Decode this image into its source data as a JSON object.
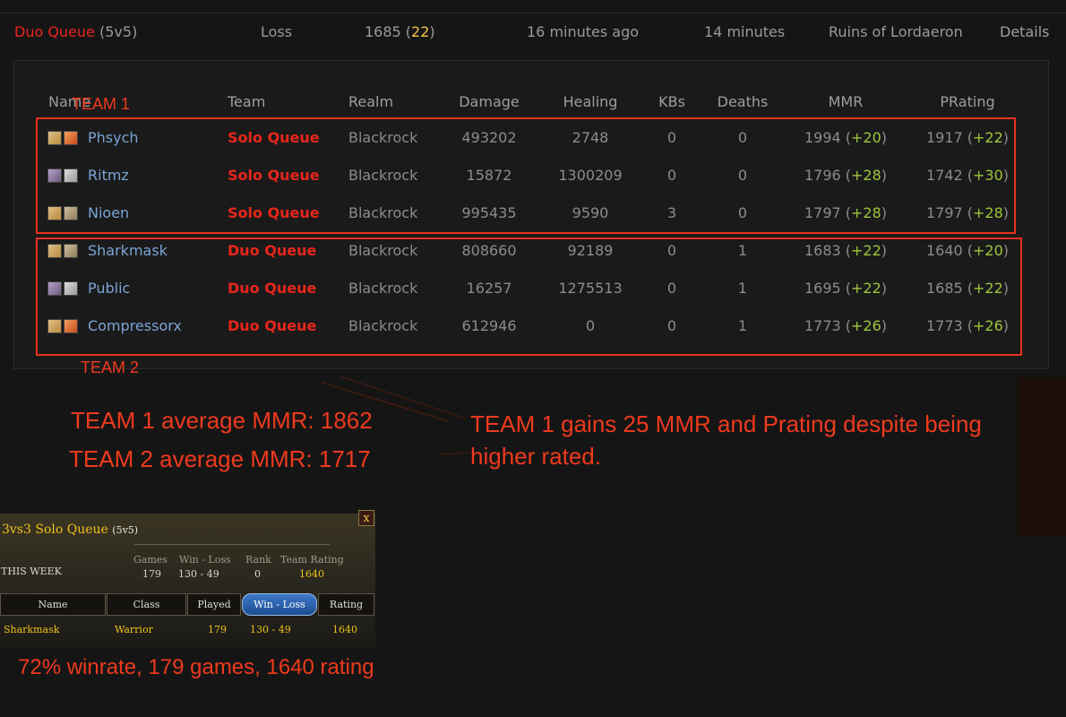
{
  "match": {
    "mode": "Duo Queue",
    "bracket": "(5v5)",
    "result": "Loss",
    "rating": "1685",
    "rating_change": "22",
    "time_ago": "16 minutes ago",
    "duration": "14 minutes",
    "map": "Ruins of Lordaeron",
    "details_label": "Details"
  },
  "table": {
    "headers": [
      "Name",
      "Team",
      "Realm",
      "Damage",
      "Healing",
      "KBs",
      "Deaths",
      "MMR",
      "PRating"
    ],
    "rows": [
      {
        "name": "Phsych",
        "team": "Solo Queue",
        "realm": "Blackrock",
        "damage": "493202",
        "healing": "2748",
        "kbs": "0",
        "deaths": "0",
        "mmr": "1994",
        "mmr_change": "+20",
        "prating": "1917",
        "prating_change": "+22",
        "icons": [
          "human-portrait-icon",
          "mage-class-icon"
        ]
      },
      {
        "name": "Ritmz",
        "team": "Solo Queue",
        "realm": "Blackrock",
        "damage": "15872",
        "healing": "1300209",
        "kbs": "0",
        "deaths": "0",
        "mmr": "1796",
        "mmr_change": "+28",
        "prating": "1742",
        "prating_change": "+30",
        "icons": [
          "nightelf-portrait-icon",
          "priest-class-icon"
        ]
      },
      {
        "name": "Nioen",
        "team": "Solo Queue",
        "realm": "Blackrock",
        "damage": "995435",
        "healing": "9590",
        "kbs": "3",
        "deaths": "0",
        "mmr": "1797",
        "mmr_change": "+28",
        "prating": "1797",
        "prating_change": "+28",
        "icons": [
          "human-portrait-icon",
          "warrior-class-icon"
        ]
      },
      {
        "name": "Sharkmask",
        "team": "Duo Queue",
        "realm": "Blackrock",
        "damage": "808660",
        "healing": "92189",
        "kbs": "0",
        "deaths": "1",
        "mmr": "1683",
        "mmr_change": "+22",
        "prating": "1640",
        "prating_change": "+20",
        "icons": [
          "human-portrait-icon",
          "warrior-class-icon"
        ]
      },
      {
        "name": "Public",
        "team": "Duo Queue",
        "realm": "Blackrock",
        "damage": "16257",
        "healing": "1275513",
        "kbs": "0",
        "deaths": "1",
        "mmr": "1695",
        "mmr_change": "+22",
        "prating": "1685",
        "prating_change": "+22",
        "icons": [
          "nightelf-portrait-icon",
          "priest-class-icon"
        ]
      },
      {
        "name": "Compressorx",
        "team": "Duo Queue",
        "realm": "Blackrock",
        "damage": "612946",
        "healing": "0",
        "kbs": "0",
        "deaths": "1",
        "mmr": "1773",
        "mmr_change": "+26",
        "prating": "1773",
        "prating_change": "+26",
        "icons": [
          "human-portrait-icon",
          "mage-class-icon"
        ]
      }
    ]
  },
  "annotations": {
    "team1_label": "TEAM  1",
    "team2_label": "TEAM 2",
    "team1_avg": "TEAM 1 average MMR: 1862",
    "team2_avg": "TEAM 2 average MMR: 1717",
    "note_line1": "TEAM 1 gains 25 MMR and Prating despite being",
    "note_line2": "higher rated.",
    "winrate": "72% winrate, 179 games, 1640 rating",
    "accent_color": "#e8321c"
  },
  "wow_panel": {
    "title": "3vs3 Solo Queue",
    "bracket": "(5v5)",
    "this_week": "THIS WEEK",
    "stat_labels": [
      "Games",
      "Win - Loss",
      "Rank",
      "Team Rating"
    ],
    "stat_values": [
      "179",
      "130 - 49",
      "0",
      "1640"
    ],
    "columns": [
      "Name",
      "Class",
      "Played",
      "Win - Loss",
      "Rating"
    ],
    "row": {
      "name": "Sharkmask",
      "class": "Warrior",
      "played": "179",
      "winloss": "130 -  49",
      "rating": "1640"
    },
    "close_label": "x"
  }
}
